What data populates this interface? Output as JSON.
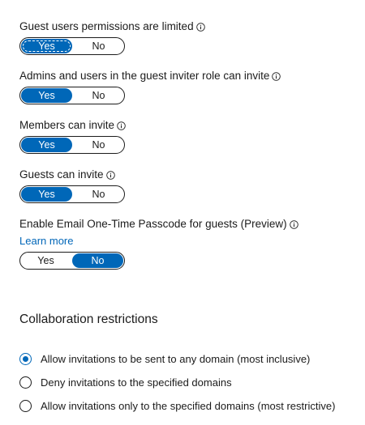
{
  "settings": [
    {
      "label": "Guest users permissions are limited",
      "yes": "Yes",
      "no": "No",
      "selected": "Yes"
    },
    {
      "label": "Admins and users in the guest inviter role can invite",
      "yes": "Yes",
      "no": "No",
      "selected": "Yes"
    },
    {
      "label": "Members can invite",
      "yes": "Yes",
      "no": "No",
      "selected": "Yes"
    },
    {
      "label": "Guests can invite",
      "yes": "Yes",
      "no": "No",
      "selected": "Yes"
    },
    {
      "label": "Enable Email One-Time Passcode for guests (Preview)",
      "yes": "Yes",
      "no": "No",
      "selected": "No",
      "link": "Learn more"
    }
  ],
  "collaboration": {
    "title": "Collaboration restrictions",
    "options": [
      {
        "label": "Allow invitations to be sent to any domain (most inclusive)",
        "checked": true
      },
      {
        "label": "Deny invitations to the specified domains",
        "checked": false
      },
      {
        "label": "Allow invitations only to the specified domains (most restrictive)",
        "checked": false
      }
    ]
  },
  "colors": {
    "accent": "#0067b8",
    "link": "#0066b8",
    "text": "#1b1b1b"
  },
  "icons": {
    "info": "info-icon"
  }
}
